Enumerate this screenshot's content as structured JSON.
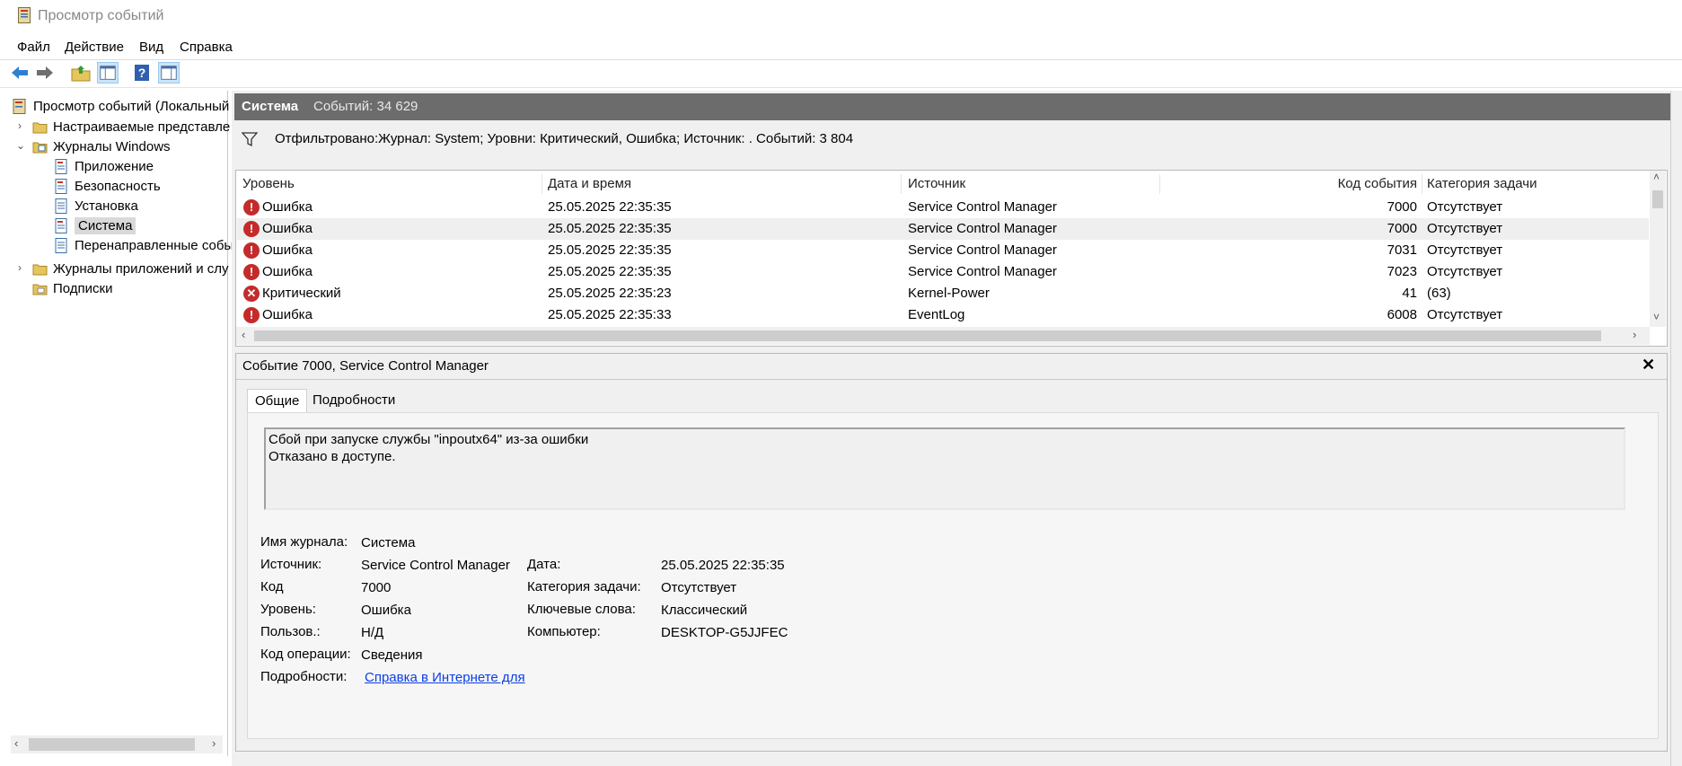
{
  "window": {
    "title": "Просмотр событий"
  },
  "menu": [
    "Файл",
    "Действие",
    "Вид",
    "Справка"
  ],
  "toolbar": [
    "back-icon",
    "forward-icon",
    "folder-up-icon",
    "console-tree-icon",
    "help-icon",
    "action-pane-icon"
  ],
  "tree": {
    "root": "Просмотр событий (Локальный",
    "custom_views": "Настраиваемые представле",
    "windows_logs": "Журналы Windows",
    "application": "Приложение",
    "security": "Безопасность",
    "setup": "Установка",
    "system": "Система",
    "forwarded": "Перенаправленные собы",
    "app_services_logs": "Журналы приложений и слу",
    "subscriptions": "Подписки"
  },
  "log_header": {
    "name": "Система",
    "count": "Событий: 34 629"
  },
  "filter": {
    "text": "Отфильтровано:Журнал: System; Уровни: Критический, Ошибка; Источник: . Событий: 3 804"
  },
  "columns": [
    "Уровень",
    "Дата и время",
    "Источник",
    "Код события",
    "Категория задачи"
  ],
  "events": [
    {
      "level": "Ошибка",
      "datetime": "25.05.2025 22:35:35",
      "source": "Service Control Manager",
      "code": "7000",
      "category": "Отсутствует"
    },
    {
      "level": "Ошибка",
      "datetime": "25.05.2025 22:35:35",
      "source": "Service Control Manager",
      "code": "7000",
      "category": "Отсутствует"
    },
    {
      "level": "Ошибка",
      "datetime": "25.05.2025 22:35:35",
      "source": "Service Control Manager",
      "code": "7031",
      "category": "Отсутствует"
    },
    {
      "level": "Ошибка",
      "datetime": "25.05.2025 22:35:35",
      "source": "Service Control Manager",
      "code": "7023",
      "category": "Отсутствует"
    },
    {
      "level": "Критический",
      "datetime": "25.05.2025 22:35:23",
      "source": "Kernel-Power",
      "code": "41",
      "category": "(63)"
    },
    {
      "level": "Ошибка",
      "datetime": "25.05.2025 22:35:33",
      "source": "EventLog",
      "code": "6008",
      "category": "Отсутствует"
    }
  ],
  "detail": {
    "title": "Событие 7000, Service Control Manager",
    "tabs": [
      "Общие",
      "Подробности"
    ],
    "message_line1": "Сбой при запуске службы \"inpoutx64\" из-за ошибки",
    "message_line2": "Отказано в доступе.",
    "labels": {
      "log_name": "Имя журнала:",
      "source": "Источник:",
      "code": "Код",
      "level": "Уровень:",
      "user": "Пользов.:",
      "opcode": "Код операции:",
      "more_info": "Подробности:",
      "date": "Дата:",
      "task_category": "Категория задачи:",
      "keywords": "Ключевые слова:",
      "computer": "Компьютер:"
    },
    "values": {
      "log_name": "Система",
      "source": "Service Control Manager",
      "code": "7000",
      "level": "Ошибка",
      "user": "Н/Д",
      "opcode": "Сведения",
      "more_info": "Справка в Интернете для",
      "date": "25.05.2025 22:35:35",
      "task_category": "Отсутствует",
      "keywords": "Классический",
      "computer": "DESKTOP-G5JJFEC"
    }
  },
  "colors": {
    "header_bar": "#6c6c6c",
    "error_icon": "#c42b2b",
    "link": "#0b3fe6",
    "selection": "#d9d9d9"
  }
}
